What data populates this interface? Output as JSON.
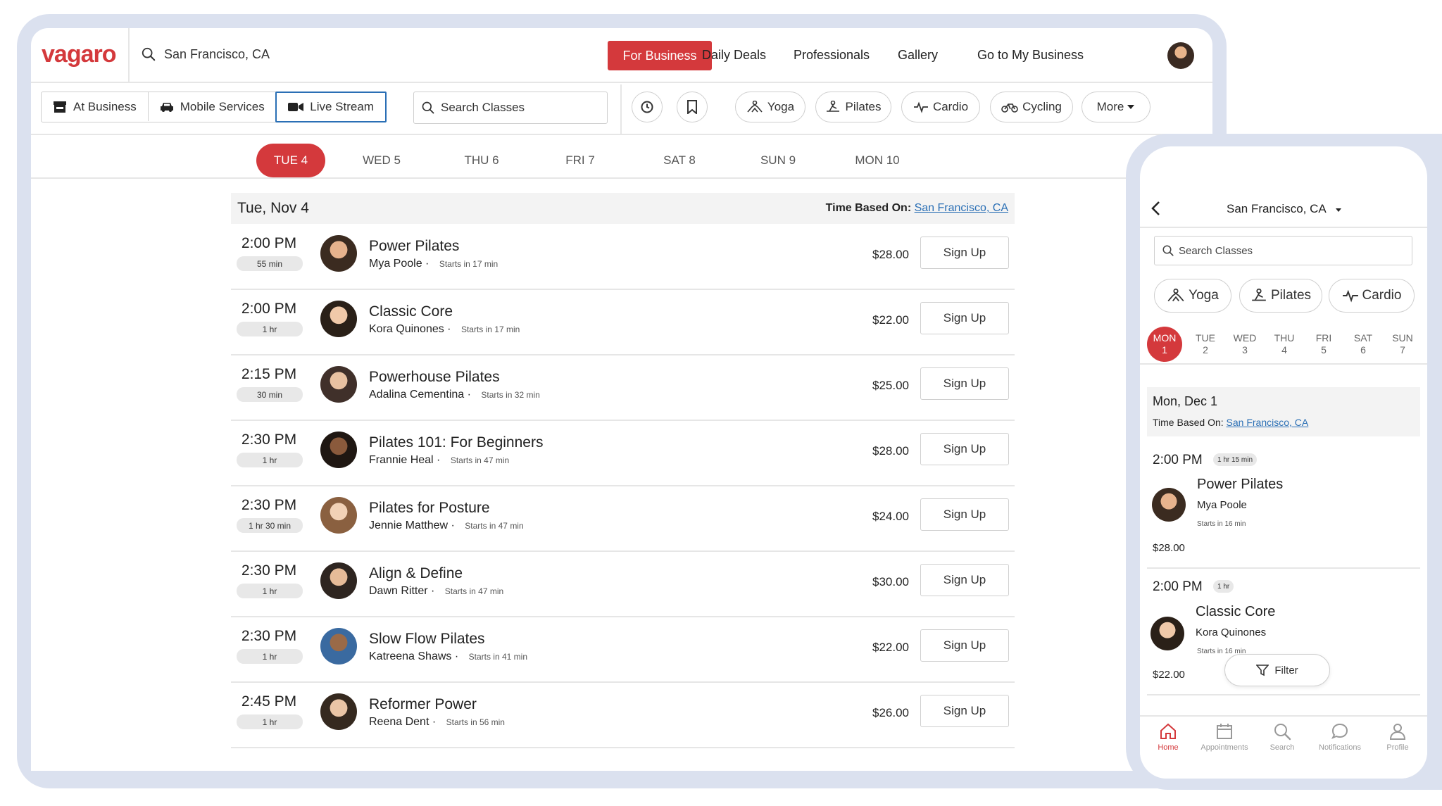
{
  "desktop": {
    "logo": "vagaro",
    "location": "San Francisco, CA",
    "for_business": "For Business",
    "nav_links": [
      "Daily Deals",
      "Professionals",
      "Gallery",
      "Go to My Business"
    ],
    "service_types": [
      "At Business",
      "Mobile Services",
      "Live Stream"
    ],
    "search_placeholder": "Search Classes",
    "categories": [
      "Yoga",
      "Pilates",
      "Cardio",
      "Cycling"
    ],
    "more_label": "More",
    "dates": [
      "TUE 4",
      "WED 5",
      "THU 6",
      "FRI 7",
      "SAT 8",
      "SUN 9",
      "MON 10"
    ],
    "day_title": "Tue, Nov 4",
    "time_based_label": "Time Based On:",
    "time_based_link": "San Francisco, CA",
    "signup_label": "Sign Up",
    "classes": [
      {
        "time": "2:00 PM",
        "duration": "55 min",
        "name": "Power Pilates",
        "instructor": "Mya Poole",
        "starts": "Starts in 17 min",
        "price": "$28.00"
      },
      {
        "time": "2:00 PM",
        "duration": "1 hr",
        "name": "Classic Core",
        "instructor": "Kora Quinones",
        "starts": "Starts in 17 min",
        "price": "$22.00"
      },
      {
        "time": "2:15 PM",
        "duration": "30 min",
        "name": "Powerhouse Pilates",
        "instructor": "Adalina Cementina",
        "starts": "Starts in 32 min",
        "price": "$25.00"
      },
      {
        "time": "2:30 PM",
        "duration": "1 hr",
        "name": "Pilates 101: For Beginners",
        "instructor": "Frannie Heal",
        "starts": "Starts in 47 min",
        "price": "$28.00"
      },
      {
        "time": "2:30 PM",
        "duration": "1 hr 30 min",
        "name": "Pilates for Posture",
        "instructor": "Jennie Matthew",
        "starts": "Starts in 47 min",
        "price": "$24.00"
      },
      {
        "time": "2:30 PM",
        "duration": "1 hr",
        "name": "Align & Define",
        "instructor": "Dawn Ritter",
        "starts": "Starts in 47 min",
        "price": "$30.00"
      },
      {
        "time": "2:30 PM",
        "duration": "1 hr",
        "name": "Slow Flow Pilates",
        "instructor": "Katreena Shaws",
        "starts": "Starts in 41 min",
        "price": "$22.00"
      },
      {
        "time": "2:45 PM",
        "duration": "1 hr",
        "name": "Reformer Power",
        "instructor": "Reena Dent",
        "starts": "Starts in 56 min",
        "price": "$26.00"
      }
    ]
  },
  "mobile": {
    "location": "San Francisco, CA",
    "search_placeholder": "Search Classes",
    "categories": [
      "Yoga",
      "Pilates",
      "Cardio"
    ],
    "days": [
      {
        "dow": "MON",
        "num": "1"
      },
      {
        "dow": "TUE",
        "num": "2"
      },
      {
        "dow": "WED",
        "num": "3"
      },
      {
        "dow": "THU",
        "num": "4"
      },
      {
        "dow": "FRI",
        "num": "5"
      },
      {
        "dow": "SAT",
        "num": "6"
      },
      {
        "dow": "SUN",
        "num": "7"
      }
    ],
    "day_title": "Mon, Dec 1",
    "time_based_label": "Time Based On:",
    "time_based_link": "San Francisco, CA",
    "classes": [
      {
        "time": "2:00 PM",
        "duration": "1 hr 15 min",
        "name": "Power Pilates",
        "instructor": "Mya Poole",
        "starts": "Starts in 16 min",
        "price": "$28.00"
      },
      {
        "time": "2:00 PM",
        "duration": "1 hr",
        "name": "Classic Core",
        "instructor": "Kora Quinones",
        "starts": "Starts in 16 min",
        "price": "$22.00"
      }
    ],
    "filter_label": "Filter",
    "tabs": [
      "Home",
      "Appointments",
      "Search",
      "Notifications",
      "Profile"
    ]
  },
  "colors": {
    "brand": "#d4393c",
    "link": "#2a6fb5",
    "frame": "#dbe1ef"
  }
}
